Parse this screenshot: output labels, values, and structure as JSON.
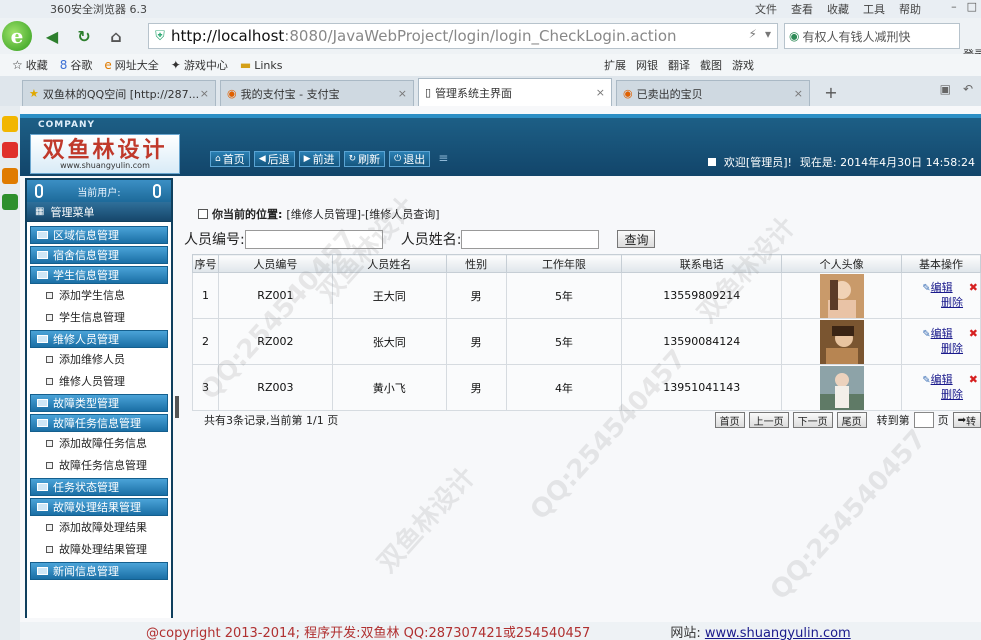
{
  "browser": {
    "window_title": "360安全浏览器 6.3",
    "menus": [
      "文件",
      "查看",
      "收藏",
      "工具",
      "帮助"
    ],
    "url_host": "http://localhost",
    "url_rest": ":8080/JavaWebProject/login/login_CheckLogin.action",
    "search_text": "有权人有钱人减刑快",
    "login_text": "登录管家",
    "bookmarks": [
      "收藏",
      "谷歌",
      "网址大全",
      "游戏中心",
      "Links"
    ],
    "bookmarks_right": [
      "扩展",
      "网银",
      "翻译",
      "截图",
      "游戏"
    ],
    "tabs": [
      {
        "label": "双鱼林的QQ空间 [http://287..."
      },
      {
        "label": "我的支付宝 - 支付宝"
      },
      {
        "label": "管理系统主界面"
      },
      {
        "label": "已卖出的宝贝"
      }
    ]
  },
  "app": {
    "company_tag": "COMPANY",
    "logo_cn": "双鱼林设计",
    "logo_url": "www.shuangyulin.com",
    "toolbar": [
      "首页",
      "后退",
      "前进",
      "刷新",
      "退出"
    ],
    "welcome": "欢迎[管理员]!",
    "now_label": "现在是: 2014年4月30日 14:58:24"
  },
  "sidebar": {
    "current_user": "当前用户:",
    "menu_title": "管理菜单",
    "items": [
      {
        "type": "group",
        "label": "区域信息管理"
      },
      {
        "type": "group",
        "label": "宿舍信息管理"
      },
      {
        "type": "group",
        "label": "学生信息管理"
      },
      {
        "type": "sub",
        "label": "添加学生信息"
      },
      {
        "type": "sub",
        "label": "学生信息管理"
      },
      {
        "type": "group",
        "label": "维修人员管理"
      },
      {
        "type": "sub",
        "label": "添加维修人员"
      },
      {
        "type": "sub",
        "label": "维修人员管理"
      },
      {
        "type": "group",
        "label": "故障类型管理"
      },
      {
        "type": "group",
        "label": "故障任务信息管理"
      },
      {
        "type": "sub",
        "label": "添加故障任务信息"
      },
      {
        "type": "sub",
        "label": "故障任务信息管理"
      },
      {
        "type": "group",
        "label": "任务状态管理"
      },
      {
        "type": "group",
        "label": "故障处理结果管理"
      },
      {
        "type": "sub",
        "label": "添加故障处理结果"
      },
      {
        "type": "sub",
        "label": "故障处理结果管理"
      },
      {
        "type": "group",
        "label": "新闻信息管理"
      }
    ]
  },
  "main": {
    "location_label": "你当前的位置:",
    "location_path": "[维修人员管理]-[维修人员查询]",
    "search": {
      "id_label": "人员编号:",
      "name_label": "人员姓名:",
      "query_button": "查询"
    },
    "columns": [
      "序号",
      "人员编号",
      "人员姓名",
      "性别",
      "工作年限",
      "联系电话",
      "个人头像",
      "基本操作"
    ],
    "rows": [
      {
        "no": "1",
        "id": "RZ001",
        "name": "王大同",
        "sex": "男",
        "years": "5年",
        "phone": "13559809214"
      },
      {
        "no": "2",
        "id": "RZ002",
        "name": "张大同",
        "sex": "男",
        "years": "5年",
        "phone": "13590084124"
      },
      {
        "no": "3",
        "id": "RZ003",
        "name": "黄小飞",
        "sex": "男",
        "years": "4年",
        "phone": "13951041143"
      }
    ],
    "edit_label": "编辑",
    "delete_label": "删除",
    "pager": {
      "info": "共有3条记录,当前第 1/1 页",
      "first": "首页",
      "prev": "上一页",
      "next": "下一页",
      "last": "尾页",
      "goto_label": "转到第",
      "page_unit": "页",
      "go": "转"
    }
  },
  "footer": {
    "copyright": "@copyright 2013-2014; 程序开发:双鱼林  QQ:287307421或254540457",
    "site_label": "网站:",
    "site_url": "www.shuangyulin.com"
  },
  "watermark": {
    "texts": [
      "QQ:254540457",
      "双鱼林设计",
      "QQ:254540457",
      "双鱼林设计",
      "QQ:254540457",
      "双鱼林设计"
    ]
  }
}
